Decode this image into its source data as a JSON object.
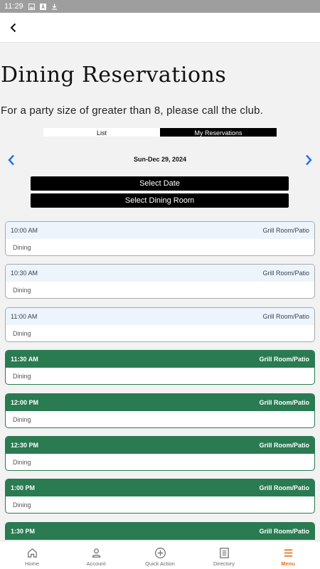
{
  "status": {
    "time": "11:29"
  },
  "page": {
    "title": "Dining Reservations",
    "subtitle": "For a party size of greater than 8, please call the club."
  },
  "tabs": {
    "list": "List",
    "mine": "My Reservations"
  },
  "date": "Sun-Dec 29, 2024",
  "buttons": {
    "select_date": "Select Date",
    "select_room": "Select Dining Room"
  },
  "slots": [
    {
      "time": "10:00 AM",
      "room": "Grill Room/Patio",
      "type": "Dining",
      "available": false
    },
    {
      "time": "10:30 AM",
      "room": "Grill Room/Patio",
      "type": "Dining",
      "available": false
    },
    {
      "time": "11:00 AM",
      "room": "Grill Room/Patio",
      "type": "Dining",
      "available": false
    },
    {
      "time": "11:30 AM",
      "room": "Grill Room/Patio",
      "type": "Dining",
      "available": true
    },
    {
      "time": "12:00 PM",
      "room": "Grill Room/Patio",
      "type": "Dining",
      "available": true
    },
    {
      "time": "12:30 PM",
      "room": "Grill Room/Patio",
      "type": "Dining",
      "available": true
    },
    {
      "time": "1:00 PM",
      "room": "Grill Room/Patio",
      "type": "Dining",
      "available": true
    },
    {
      "time": "1:30 PM",
      "room": "Grill Room/Patio",
      "type": "Dining",
      "available": true
    }
  ],
  "bottom_nav": [
    {
      "label": "Home",
      "icon": "home-icon",
      "active": false
    },
    {
      "label": "Account",
      "icon": "account-icon",
      "active": false
    },
    {
      "label": "Quick Action",
      "icon": "plus-circle-icon",
      "active": false
    },
    {
      "label": "Directory",
      "icon": "directory-icon",
      "active": false
    },
    {
      "label": "Menu",
      "icon": "menu-icon",
      "active": true
    }
  ],
  "colors": {
    "available": "#2a7a52",
    "unavailable_header": "#eef4fb",
    "accent": "#e8731c",
    "nav_arrow": "#1a73e8"
  }
}
